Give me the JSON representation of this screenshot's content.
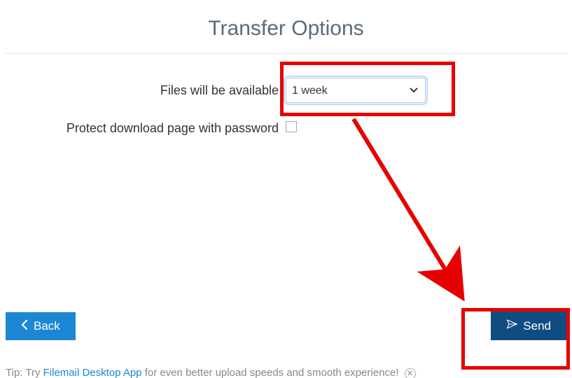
{
  "title": "Transfer Options",
  "form": {
    "availability_label": "Files will be available",
    "availability_value": "1 week",
    "password_label": "Protect download page with password",
    "password_checked": false
  },
  "buttons": {
    "back": "Back",
    "send": "Send"
  },
  "tip": {
    "prefix": "Tip: Try ",
    "link_text": "Filemail Desktop App",
    "suffix": " for even better upload speeds and smooth experience! "
  },
  "annotation": {
    "highlight_select": true,
    "highlight_send": true,
    "arrow_color": "#e60000"
  }
}
